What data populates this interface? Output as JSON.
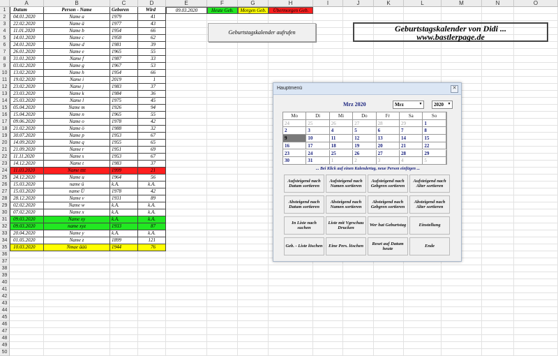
{
  "columns": [
    "A",
    "B",
    "C",
    "D",
    "E",
    "F",
    "G",
    "H",
    "I",
    "J",
    "K",
    "L",
    "M",
    "N",
    "O"
  ],
  "rows": [
    "1",
    "2",
    "3",
    "4",
    "5",
    "6",
    "7",
    "8",
    "9",
    "10",
    "11",
    "12",
    "13",
    "14",
    "15",
    "16",
    "17",
    "18",
    "19",
    "20",
    "21",
    "22",
    "23",
    "24",
    "25",
    "26",
    "27",
    "28",
    "29",
    "30",
    "31",
    "32",
    "33",
    "34",
    "35",
    "36",
    "37",
    "38",
    "39",
    "40",
    "41",
    "42",
    "43",
    "44",
    "45",
    "46",
    "47",
    "48",
    "49",
    "50"
  ],
  "table_headers": {
    "a": "Datum",
    "b": "Person - Name",
    "c": "Geboren",
    "d": "Wird"
  },
  "table_rows": [
    {
      "a": "04.01.2020",
      "b": "Name a",
      "c": "1979",
      "d": "41"
    },
    {
      "a": "22.02.2020",
      "b": "Name ä",
      "c": "1977",
      "d": "43"
    },
    {
      "a": "11.01.2020",
      "b": "Name b",
      "c": "1954",
      "d": "66"
    },
    {
      "a": "14.01.2020",
      "b": "Name c",
      "c": "1958",
      "d": "62"
    },
    {
      "a": "24.01.2020",
      "b": "Name d",
      "c": "1981",
      "d": "39"
    },
    {
      "a": "26.01.2020",
      "b": "Name e",
      "c": "1965",
      "d": "55"
    },
    {
      "a": "31.01.2020",
      "b": "Name f",
      "c": "1987",
      "d": "33"
    },
    {
      "a": "03.02.2020",
      "b": "Name g",
      "c": "1967",
      "d": "53"
    },
    {
      "a": "13.02.2020",
      "b": "Name h",
      "c": "1954",
      "d": "66"
    },
    {
      "a": "19.02.2020",
      "b": "Name i",
      "c": "2019",
      "d": "1"
    },
    {
      "a": "23.02.2020",
      "b": "Name j",
      "c": "1983",
      "d": "37"
    },
    {
      "a": "23.03.2020",
      "b": "Name k",
      "c": "1984",
      "d": "36"
    },
    {
      "a": "25.03.2020",
      "b": "Name l",
      "c": "1975",
      "d": "45"
    },
    {
      "a": "05.04.2020",
      "b": "Name m",
      "c": "1926",
      "d": "94"
    },
    {
      "a": "15.04.2020",
      "b": "Name n",
      "c": "1965",
      "d": "55"
    },
    {
      "a": "09.06.2020",
      "b": "Name o",
      "c": "1978",
      "d": "42"
    },
    {
      "a": "21.02.2020",
      "b": "Name ö",
      "c": "1988",
      "d": "32"
    },
    {
      "a": "30.07.2020",
      "b": "Name p",
      "c": "1953",
      "d": "67"
    },
    {
      "a": "14.09.2020",
      "b": "Name q",
      "c": "1955",
      "d": "65"
    },
    {
      "a": "21.09.2020",
      "b": "Name r",
      "c": "1951",
      "d": "69"
    },
    {
      "a": "11.11.2020",
      "b": "Name s",
      "c": "1953",
      "d": "67"
    },
    {
      "a": "14.12.2020",
      "b": "Name t",
      "c": "1983",
      "d": "37"
    },
    {
      "a": "11.03.2020",
      "b": "Name tttt",
      "c": "1999",
      "d": "21",
      "bg": "#ff1f1f"
    },
    {
      "a": "24.12.2020",
      "b": "Name u",
      "c": "1964",
      "d": "56"
    },
    {
      "a": "15.03.2020",
      "b": "name ü",
      "c": "k.A.",
      "d": "k.A."
    },
    {
      "a": "15.03.2020",
      "b": "name Ü",
      "c": "1978",
      "d": "42"
    },
    {
      "a": "28.12.2020",
      "b": "Name v",
      "c": "1931",
      "d": "89"
    },
    {
      "a": "02.02.2020",
      "b": "Name w",
      "c": "k.A.",
      "d": "k.A."
    },
    {
      "a": "07.02.2020",
      "b": "Name x",
      "c": "k.A.",
      "d": "k.A."
    },
    {
      "a": "09.03.2020",
      "b": "Name xy",
      "c": "k.A.",
      "d": "k.A.",
      "bg": "#22e822"
    },
    {
      "a": "09.03.2020",
      "b": "name xyz",
      "c": "1933",
      "d": "87",
      "bg": "#22e822"
    },
    {
      "a": "20.04.2020",
      "b": "Name y",
      "c": "k.A.",
      "d": "k.A."
    },
    {
      "a": "01.05.2020",
      "b": "Name z",
      "c": "1899",
      "d": "121"
    },
    {
      "a": "10.03.2020",
      "b": "Nmae ääü",
      "c": "1944",
      "d": "76",
      "bg": "#ffff00"
    }
  ],
  "top_row": {
    "date": "09.03.2020",
    "heute": {
      "label": "Heute Geb.",
      "bg": "#22e822"
    },
    "morgen": {
      "label": "Morgen Geb.",
      "bg": "#ffff00"
    },
    "uebermorgen": {
      "label": "Übermorgen Geb.",
      "bg": "#ff1f1f"
    }
  },
  "sheet_button": "Geburtstagskalender aufrufen",
  "brand": {
    "line1": "Geburtstagskalender von Didi ...",
    "line2": "www.bastlerpage.de"
  },
  "dialog": {
    "title": "Hauptmenü",
    "close": "✕",
    "month_title": "Mrz 2020",
    "month_select": "Mrz",
    "year_select": "2020",
    "weekdays": [
      "Mo",
      "Di",
      "Mi",
      "Do",
      "Fr",
      "Sa",
      "So"
    ],
    "weeks": [
      [
        {
          "d": "24",
          "dim": true
        },
        {
          "d": "25",
          "dim": true
        },
        {
          "d": "26",
          "dim": true
        },
        {
          "d": "27",
          "dim": true
        },
        {
          "d": "28",
          "dim": true
        },
        {
          "d": "29",
          "dim": true
        },
        {
          "d": "1"
        }
      ],
      [
        {
          "d": "2"
        },
        {
          "d": "3"
        },
        {
          "d": "4"
        },
        {
          "d": "5"
        },
        {
          "d": "6"
        },
        {
          "d": "7"
        },
        {
          "d": "8"
        }
      ],
      [
        {
          "d": "9",
          "today": true
        },
        {
          "d": "10"
        },
        {
          "d": "11"
        },
        {
          "d": "12"
        },
        {
          "d": "13"
        },
        {
          "d": "14"
        },
        {
          "d": "15"
        }
      ],
      [
        {
          "d": "16"
        },
        {
          "d": "17"
        },
        {
          "d": "18"
        },
        {
          "d": "19"
        },
        {
          "d": "20"
        },
        {
          "d": "21"
        },
        {
          "d": "22"
        }
      ],
      [
        {
          "d": "23"
        },
        {
          "d": "24"
        },
        {
          "d": "25"
        },
        {
          "d": "26"
        },
        {
          "d": "27"
        },
        {
          "d": "28"
        },
        {
          "d": "29"
        }
      ],
      [
        {
          "d": "30"
        },
        {
          "d": "31"
        },
        {
          "d": "1",
          "dim": true
        },
        {
          "d": "2",
          "dim": true
        },
        {
          "d": "3",
          "dim": true
        },
        {
          "d": "4",
          "dim": true
        },
        {
          "d": "5",
          "dim": true
        }
      ]
    ],
    "hint": "... Bei Klick auf einen Kalendertag, neue Person einfügen ...",
    "buttons": [
      [
        "Aufsteigend nach Datum sortieren",
        "Aufsteigend nach Namen sortieren",
        "Aufsteigend nach Gebgren sortieren",
        "Aufsteigend nach Alter sortieren"
      ],
      [
        "Absteigend nach Datum sortieren",
        "Absteigend nach Namen sortieren",
        "Absteigend nach Gebgren sortieren",
        "Absteigend nach Alter sortieren"
      ],
      [
        "In Liste nach suchen",
        "Liste mit Vgrschau Drucken",
        "Wer hat Geburtstag",
        "Einstellung"
      ],
      [
        "Geb. - Liste löschen",
        "Eine Pers. löschen",
        "Reset auf Datum heute",
        "Ende"
      ]
    ]
  }
}
